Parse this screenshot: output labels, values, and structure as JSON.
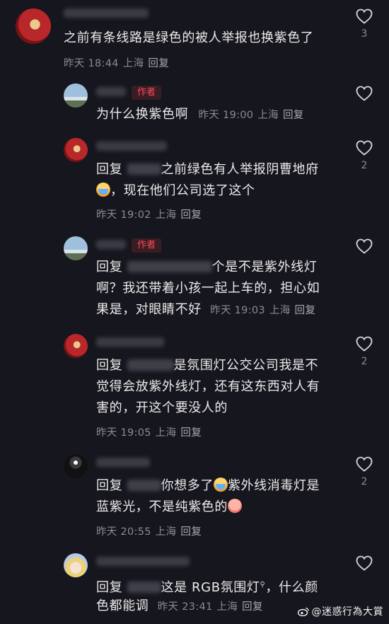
{
  "comments": [
    {
      "text": "之前有条线路是绿色的被人举报也换紫色了",
      "time": "昨天 18:44",
      "location": "上海",
      "reply_label": "回复",
      "likes": "3"
    },
    {
      "author_tag": "作者",
      "text": "为什么换紫色啊",
      "time": "昨天 19:00",
      "location": "上海",
      "reply_label": "回复",
      "likes": ""
    },
    {
      "reply_prefix": "回复",
      "text_a": "之前绿色有人举报阴曹地府",
      "text_b": "，现在他们公司选了这个",
      "time": "昨天 19:02",
      "location": "上海",
      "reply_label": "回复",
      "likes": "2"
    },
    {
      "author_tag": "作者",
      "reply_prefix": "回复",
      "text_a": "个是不是紫外线灯",
      "text_b": "啊？我还带着小孩一起上车的，担心如",
      "text_c": "果是，对眼睛不好",
      "time": "昨天 19:03",
      "location": "上海",
      "reply_label": "回复",
      "likes": ""
    },
    {
      "reply_prefix": "回复",
      "text_a": "是氛围灯公交公司我是不",
      "text_b": "觉得会放紫外线灯，还有这东西对人有",
      "text_c": "害的，开这个要没人的",
      "time": "昨天 19:05",
      "location": "上海",
      "reply_label": "回复",
      "likes": "2"
    },
    {
      "reply_prefix": "回复",
      "text_a": "你想多了",
      "text_b": "紫外线消毒灯是",
      "text_c": "蓝紫光，不是纯紫色的",
      "time": "昨天 20:55",
      "location": "上海",
      "reply_label": "回复",
      "likes": "2"
    },
    {
      "reply_prefix": "回复",
      "text_a": "这是 RGB氛围灯",
      "text_b": "，什么颜",
      "text_c": "色都能调",
      "time": "昨天 23:41",
      "location": "上海",
      "reply_label": "回复",
      "likes": ""
    }
  ],
  "watermark": "@迷惑行為大賞",
  "icons": {
    "like": "heart-outline-icon",
    "search": "search-icon",
    "weibo": "weibo-logo-icon"
  },
  "colors": {
    "background": "#16161e",
    "author_tag": "#ff4a5e",
    "meta": "#8a8a92"
  }
}
